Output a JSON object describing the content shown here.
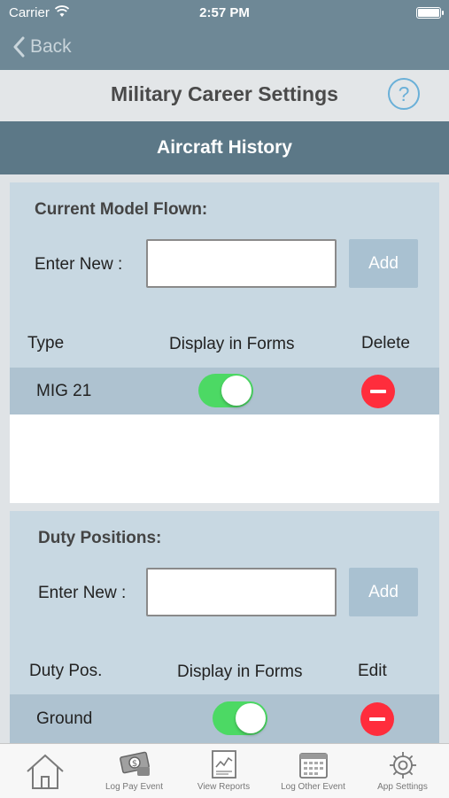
{
  "status_bar": {
    "carrier": "Carrier",
    "time": "2:57 PM"
  },
  "nav": {
    "back_label": "Back"
  },
  "header": {
    "title": "Military Career Settings",
    "help_glyph": "?"
  },
  "section": {
    "title": "Aircraft History"
  },
  "model_panel": {
    "heading": "Current Model Flown:",
    "enter_label": "Enter New :",
    "input_value": "",
    "add_label": "Add",
    "columns": [
      "Type",
      "Display in Forms",
      "Delete"
    ],
    "rows": [
      {
        "type": "MIG 21",
        "display_in_forms": true
      }
    ]
  },
  "duty_panel": {
    "heading": "Duty Positions:",
    "enter_label": "Enter New :",
    "input_value": "",
    "add_label": "Add",
    "columns": [
      "Duty Pos.",
      "Display in Forms",
      "Edit"
    ],
    "rows": [
      {
        "position": "Ground",
        "display_in_forms": true
      }
    ]
  },
  "tabbar": {
    "items": [
      {
        "label": "",
        "icon": "home-icon"
      },
      {
        "label": "Log Pay Event",
        "icon": "money-icon"
      },
      {
        "label": "View Reports",
        "icon": "report-icon"
      },
      {
        "label": "Log Other Event",
        "icon": "calendar-icon"
      },
      {
        "label": "App Settings",
        "icon": "gear-icon"
      }
    ]
  },
  "colors": {
    "nav_bg": "#6e8896",
    "section_bg": "#5c7887",
    "panel_bg": "#c8d8e2",
    "row_bg": "#aec2d0",
    "toggle_on": "#4cd964",
    "delete_red": "#ff2d3c",
    "help_blue": "#6ab0d8"
  }
}
